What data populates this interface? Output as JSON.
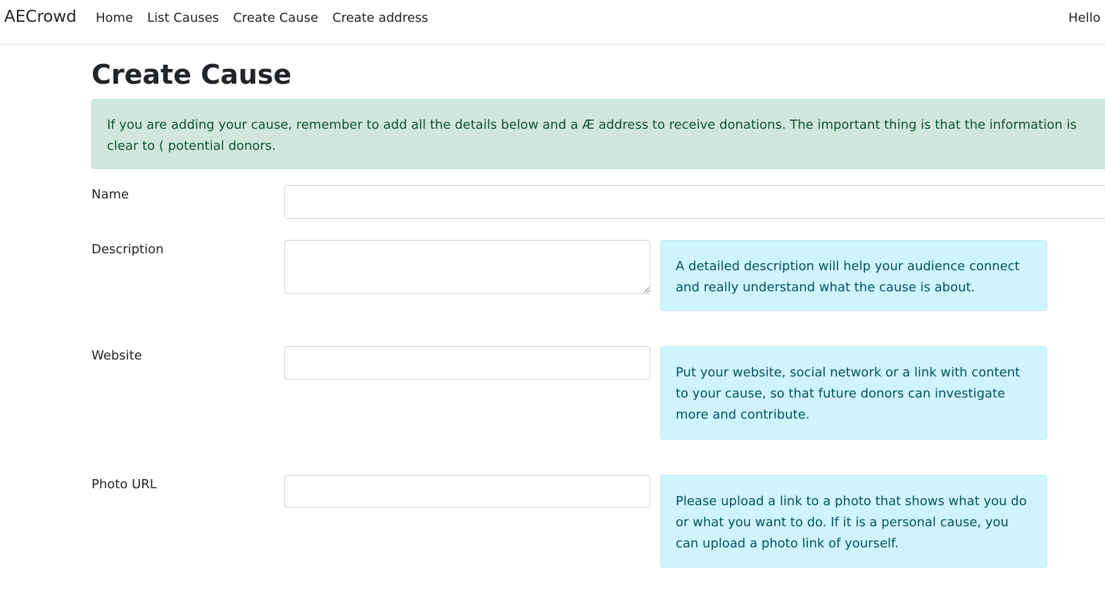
{
  "navbar": {
    "brand": "AECrowd",
    "links": [
      "Home",
      "List Causes",
      "Create Cause",
      "Create address"
    ],
    "greeting": "Hello"
  },
  "page": {
    "title": "Create Cause",
    "intro": "If you are adding your cause, remember to add all the details below and a Æ address to receive donations. The important thing is that the information is clear to ( potential donors."
  },
  "form": {
    "name": {
      "label": "Name",
      "value": ""
    },
    "description": {
      "label": "Description",
      "value": "",
      "help": "A detailed description will help your audience connect and really understand what the cause is about."
    },
    "website": {
      "label": "Website",
      "value": "",
      "help": "Put your website, social network or a link with content to your cause, so that future donors can investigate more and contribute."
    },
    "photo_url": {
      "label": "Photo URL",
      "value": "",
      "help": "Please upload a link to a photo that shows what you do or what you want to do. If it is a personal cause, you can upload a photo link of yourself."
    }
  }
}
